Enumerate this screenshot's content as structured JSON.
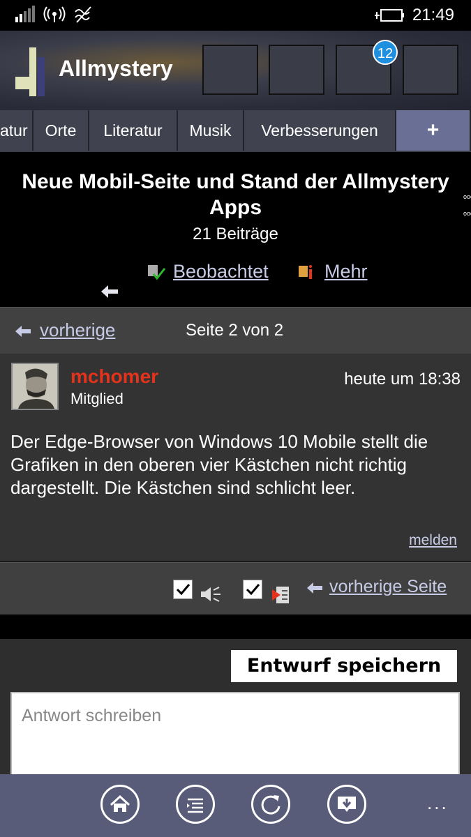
{
  "status": {
    "time": "21:49"
  },
  "header": {
    "logo_text": "Allmystery",
    "badge_count": "12"
  },
  "tabs": [
    {
      "label": "atur"
    },
    {
      "label": "Orte"
    },
    {
      "label": "Literatur"
    },
    {
      "label": "Musik"
    },
    {
      "label": "Verbesserungen"
    },
    {
      "label": "+"
    }
  ],
  "thread": {
    "title": "Neue Mobil-Seite und Stand der Allmystery Apps",
    "post_count": "21 Beiträge",
    "watch_label": "Beobachtet",
    "more_label": "Mehr"
  },
  "pager": {
    "prev_label": "vorherige",
    "page_info": "Seite 2 von 2"
  },
  "post": {
    "username": "mchomer",
    "role": "Mitglied",
    "time": "heute um 18:38",
    "text": "Der Edge-Browser von Windows 10 Mobile stellt die Grafiken in den oberen vier Kästchen nicht richtig dargestellt. Die Kästchen sind schlicht leer.",
    "report_label": "melden"
  },
  "actions": {
    "prev_page_label": "vorherige Seite"
  },
  "reply": {
    "save_draft_label": "Entwurf speichern",
    "placeholder": "Antwort schreiben"
  },
  "appbar": {
    "more_label": "..."
  },
  "colors": {
    "username": "#e5331b",
    "tab_plus": "#6a6f96",
    "badge": "#1f8fe0",
    "appbar": "#585c78"
  }
}
